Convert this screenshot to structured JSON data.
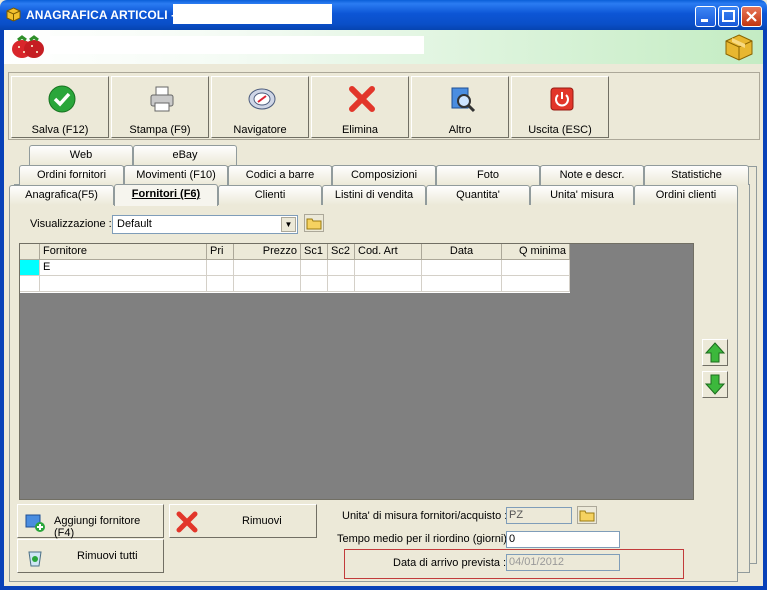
{
  "window": {
    "title": "ANAGRAFICA ARTICOLI -"
  },
  "toolbar": [
    {
      "label": "Salva (F12)",
      "icon": "check-icon"
    },
    {
      "label": "Stampa (F9)",
      "icon": "printer-icon"
    },
    {
      "label": "Navigatore",
      "icon": "navigator-icon"
    },
    {
      "label": "Elimina",
      "icon": "delete-x-icon"
    },
    {
      "label": "Altro",
      "icon": "magnifier-icon"
    },
    {
      "label": "Uscita (ESC)",
      "icon": "power-icon"
    }
  ],
  "tabs_row3": [
    "Web",
    "eBay"
  ],
  "tabs_row2": [
    "Ordini fornitori",
    "Movimenti (F10)",
    "Codici a barre",
    "Composizioni",
    "Foto",
    "Note e descr.",
    "Statistiche"
  ],
  "tabs_row1": [
    "Anagrafica(F5)",
    "Fornitori (F6)",
    "Clienti",
    "Listini di vendita",
    "Quantita'",
    "Unita' misura",
    "Ordini clienti"
  ],
  "view": {
    "label": "Visualizzazione :",
    "value": "Default"
  },
  "grid": {
    "columns": [
      "Fornitore",
      "Pri",
      "Prezzo",
      "Sc1",
      "Sc2",
      "Cod. Art",
      "Data",
      "Q minima"
    ],
    "rows": [
      [
        "E",
        "",
        "",
        "",
        "",
        "",
        "",
        ""
      ],
      [
        "",
        "",
        "",
        "",
        "",
        "",
        "",
        ""
      ]
    ]
  },
  "buttons": {
    "add": "Aggiungi fornitore (F4)",
    "remove": "Rimuovi",
    "remove_all": "Rimuovi tutti"
  },
  "fields": {
    "unit_label": "Unita' di misura fornitori/acquisto :",
    "unit_value": "PZ",
    "reorder_label": "Tempo medio per il riordino (giorni) :",
    "reorder_value": "0",
    "arrival_label": "Data di arrivo prevista :",
    "arrival_value": "04/01/2012"
  },
  "colors": {
    "accent": "#0a4fc8",
    "header_green": "#c4ecc3",
    "arrival_border": "#c23b3b"
  }
}
